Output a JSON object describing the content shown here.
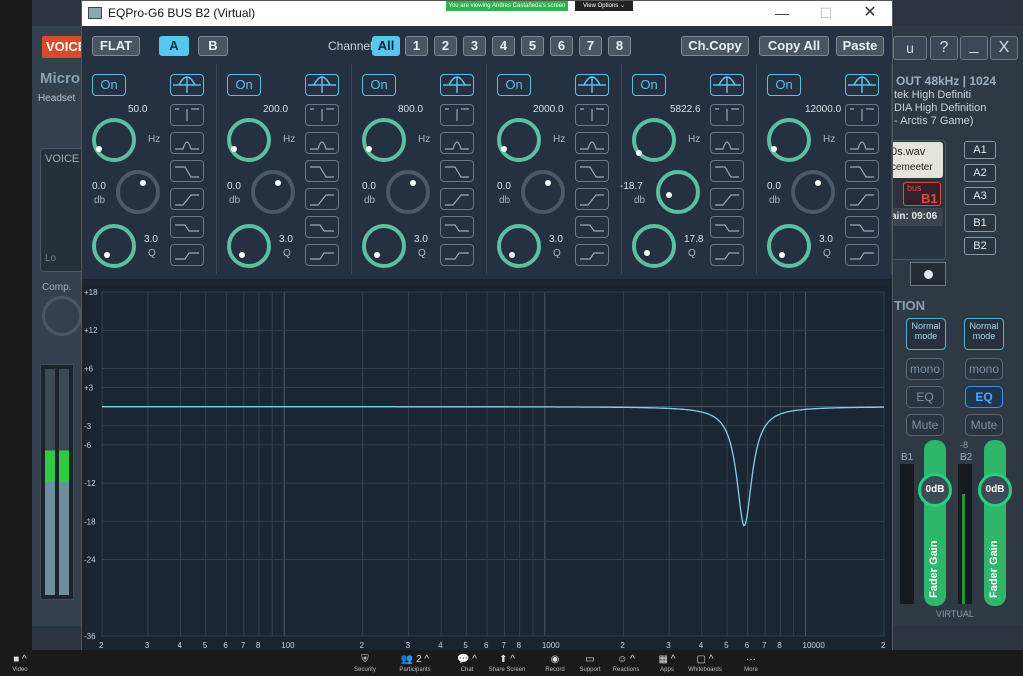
{
  "window": {
    "title": "EQPro-G6 BUS B2 (Virtual)",
    "minimize": "—",
    "maximize": "☐",
    "close": "✕"
  },
  "zoom_banner": {
    "text": "You are viewing Andres Castañeda's screen",
    "view_options": "View Options ⌄"
  },
  "toolbar": {
    "flat": "FLAT",
    "a": "A",
    "b": "B",
    "channel_label": "Channel:",
    "channels": [
      "All",
      "1",
      "2",
      "3",
      "4",
      "5",
      "6",
      "7",
      "8"
    ],
    "copy": "Ch.Copy",
    "copy_all": "Copy All",
    "paste": "Paste"
  },
  "bands": [
    {
      "on": "On",
      "freq": "50.0",
      "gain": "0.0",
      "q": "3.0",
      "hz": "Hz",
      "db": "db",
      "qlabel": "Q"
    },
    {
      "on": "On",
      "freq": "200.0",
      "gain": "0.0",
      "q": "3.0",
      "hz": "Hz",
      "db": "db",
      "qlabel": "Q"
    },
    {
      "on": "On",
      "freq": "800.0",
      "gain": "0.0",
      "q": "3.0",
      "hz": "Hz",
      "db": "db",
      "qlabel": "Q"
    },
    {
      "on": "On",
      "freq": "2000.0",
      "gain": "0.0",
      "q": "3.0",
      "hz": "Hz",
      "db": "db",
      "qlabel": "Q"
    },
    {
      "on": "On",
      "freq": "5822.6",
      "gain": "-18.7",
      "q": "17.8",
      "hz": "Hz",
      "db": "db",
      "qlabel": "Q"
    },
    {
      "on": "On",
      "freq": "12000.0",
      "gain": "0.0",
      "q": "3.0",
      "hz": "Hz",
      "db": "db",
      "qlabel": "Q"
    }
  ],
  "graph": {
    "y_ticks": [
      "+18",
      "+12",
      "+6",
      "+3",
      "-3",
      "-6",
      "-12",
      "-18",
      "-24",
      "-36"
    ],
    "x_ticks": [
      "2",
      "3",
      "4",
      "5",
      "6",
      "7",
      "8",
      "100",
      "2",
      "3",
      "4",
      "5",
      "6",
      "7",
      "8",
      "1000",
      "2",
      "3",
      "4",
      "5",
      "6",
      "7",
      "8",
      "10000",
      "2"
    ],
    "curve_color": "#7fd0f0",
    "notch_freq_hz": 5822.6,
    "notch_gain_db": -18.7
  },
  "background_app": {
    "voice_btn": "VOICE",
    "micro": "Micro",
    "headset": "Headset",
    "voice_panel": "VOICE",
    "lo": "Lo",
    "comp": "Comp.",
    "right_title": "u",
    "help": "?",
    "min": "_",
    "close": "X",
    "out": "OUT  48kHz | 1024",
    "dev1": "tek High Definiti",
    "dev2": "DIA High Definition",
    "dev3": "- Arctis 7 Game)",
    "file": "0s.wav",
    "file2": "cemeeter",
    "bus": "bus",
    "b1": "B1",
    "timer": "ain: 09:06",
    "routes": [
      "A1",
      "A2",
      "A3",
      "B1",
      "B2"
    ],
    "tion": "TION",
    "normal_mode": "Normal mode",
    "mono": "mono",
    "eq": "EQ",
    "mute": "Mute",
    "b1_label": "B1",
    "b2_label": "B2",
    "fader_db": "0dB",
    "fader_gain": "Fader Gain",
    "virtual": "VIRTUAL",
    "meter_label": "-8"
  },
  "zoom_bar": [
    {
      "icon": "■ ^",
      "label": "Video"
    },
    {
      "icon": "⛨",
      "label": "Security"
    },
    {
      "icon": "👥 2 ^",
      "label": "Participants"
    },
    {
      "icon": "💬 ^",
      "label": "Chat"
    },
    {
      "icon": "⬆ ^",
      "label": "Share Screen"
    },
    {
      "icon": "◉",
      "label": "Record"
    },
    {
      "icon": "▭",
      "label": "Support"
    },
    {
      "icon": "☺ ^",
      "label": "Reactions"
    },
    {
      "icon": "▦ ^",
      "label": "Apps"
    },
    {
      "icon": "▢ ^",
      "label": "Whiteboards"
    },
    {
      "icon": "···",
      "label": "More"
    }
  ]
}
